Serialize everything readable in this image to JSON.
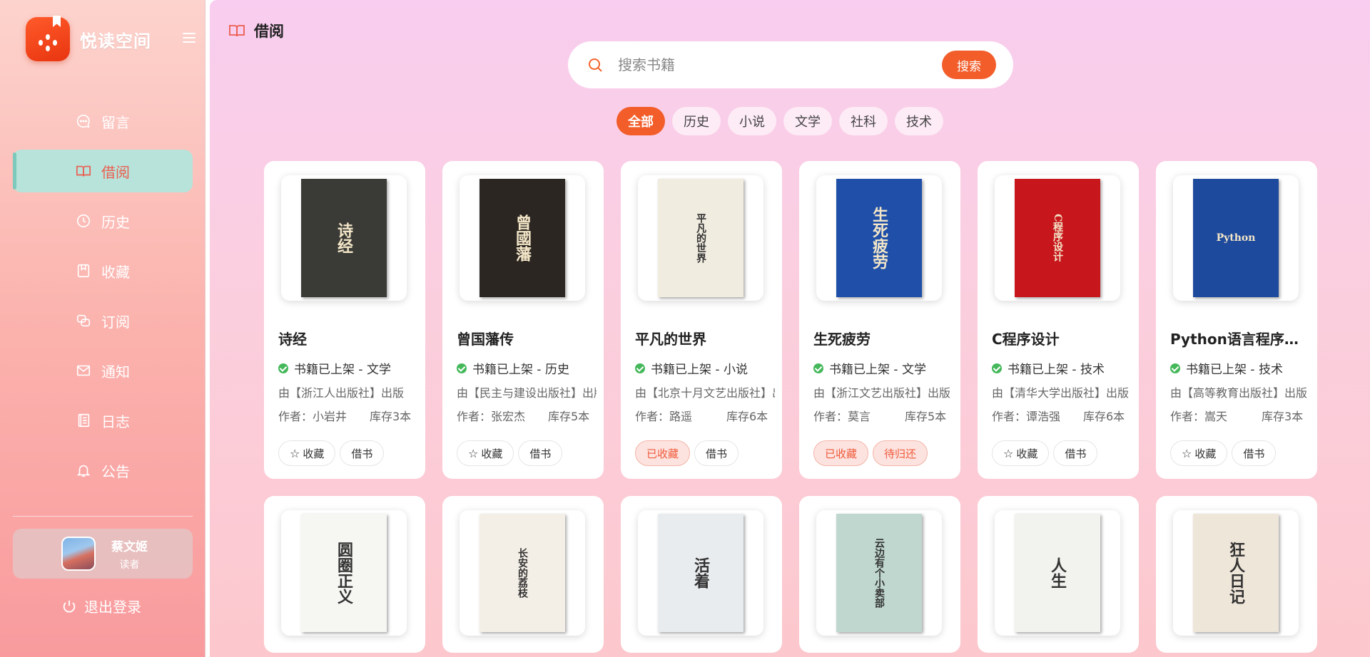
{
  "brand": {
    "name": "悦读空间"
  },
  "nav": [
    {
      "label": "留言",
      "icon": "message-icon"
    },
    {
      "label": "借阅",
      "icon": "book-open-icon",
      "active": true
    },
    {
      "label": "历史",
      "icon": "clock-icon"
    },
    {
      "label": "收藏",
      "icon": "bookmark-icon"
    },
    {
      "label": "订阅",
      "icon": "subscribe-icon"
    },
    {
      "label": "通知",
      "icon": "mail-icon"
    },
    {
      "label": "日志",
      "icon": "log-icon"
    },
    {
      "label": "公告",
      "icon": "bell-icon"
    }
  ],
  "user": {
    "name": "蔡文姬",
    "role": "读者"
  },
  "logout_label": "退出登录",
  "page_title": "借阅",
  "search": {
    "placeholder": "搜索书籍",
    "button_label": "搜索"
  },
  "categories": [
    "全部",
    "历史",
    "小说",
    "文学",
    "社科",
    "技术"
  ],
  "active_category": "全部",
  "books": [
    {
      "title": "诗经",
      "cover_text": "诗经",
      "status": "书籍已上架 - 文学",
      "publisher": "由【浙江人出版社】出版",
      "author": "作者：小岩井",
      "stock": "库存3本",
      "actions": [
        "收藏",
        "借书"
      ],
      "cover_color": "#3a3a36"
    },
    {
      "title": "曾国藩传",
      "cover_text": "曾國藩",
      "status": "书籍已上架 - 历史",
      "publisher": "由【民主与建设出版社】出版",
      "author": "作者：张宏杰",
      "stock": "库存5本",
      "actions": [
        "收藏",
        "借书"
      ],
      "cover_color": "#2b2622"
    },
    {
      "title": "平凡的世界",
      "cover_text": "平凡的世界",
      "status": "书籍已上架 - 小说",
      "publisher": "由【北京十月文艺出版社】出版",
      "author": "作者：路遥",
      "stock": "库存6本",
      "actions": [
        "已收藏",
        "借书"
      ],
      "cover_color": "#f1ece0"
    },
    {
      "title": "生死疲劳",
      "cover_text": "生死疲劳",
      "status": "书籍已上架 - 文学",
      "publisher": "由【浙江文艺出版社】出版",
      "author": "作者：莫言",
      "stock": "库存5本",
      "actions": [
        "已收藏",
        "待归还"
      ],
      "cover_color": "#1f4fa8"
    },
    {
      "title": "C程序设计",
      "cover_text": "C程序设计",
      "status": "书籍已上架 - 技术",
      "publisher": "由【清华大学出版社】出版",
      "author": "作者：谭浩强",
      "stock": "库存6本",
      "actions": [
        "收藏",
        "借书"
      ],
      "cover_color": "#c8161d"
    },
    {
      "title": "Python语言程序设计基础",
      "cover_text": "Python",
      "status": "书籍已上架 - 技术",
      "publisher": "由【高等教育出版社】出版",
      "author": "作者：嵩天",
      "stock": "库存3本",
      "actions": [
        "收藏",
        "借书"
      ],
      "cover_color": "#1d4a9c"
    },
    {
      "cover_text": "圆圈正义",
      "cover_color": "#f6f6f3"
    },
    {
      "cover_text": "长安的荔枝",
      "cover_color": "#f4efe6"
    },
    {
      "cover_text": "活着",
      "cover_color": "#e9ecef"
    },
    {
      "cover_text": "云边有个小卖部",
      "cover_color": "#bfd7cf"
    },
    {
      "cover_text": "人生",
      "cover_color": "#f2f2ef"
    },
    {
      "cover_text": "狂人日记",
      "cover_color": "#efe6da"
    }
  ]
}
